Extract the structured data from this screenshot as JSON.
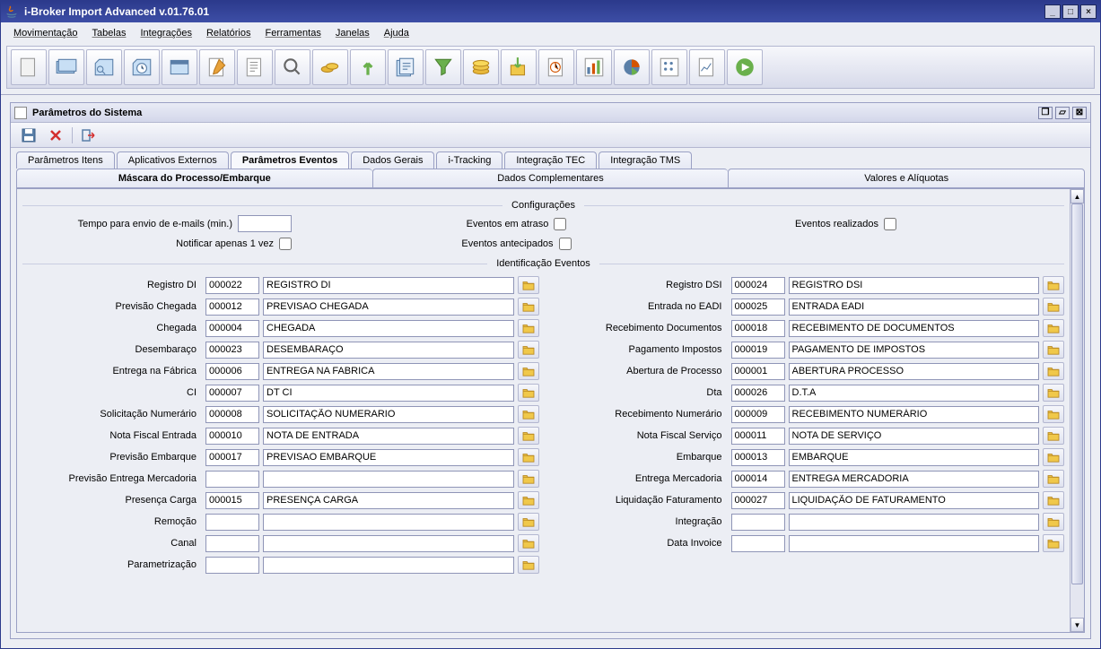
{
  "window": {
    "title": "i-Broker Import Advanced v.01.76.01"
  },
  "menus": [
    "Movimentação",
    "Tabelas",
    "Integrações",
    "Relatórios",
    "Ferramentas",
    "Janelas",
    "Ajuda"
  ],
  "inner": {
    "title": "Parâmetros do Sistema"
  },
  "tabs": [
    "Parâmetros Itens",
    "Aplicativos Externos",
    "Parâmetros Eventos",
    "Dados Gerais",
    "i-Tracking",
    "Integração TEC",
    "Integração TMS"
  ],
  "activeTab": 2,
  "subtabs": [
    "Máscara do Processo/Embarque",
    "Dados Complementares",
    "Valores e Alíquotas"
  ],
  "sections": {
    "config": "Configurações",
    "ident": "Identificação Eventos"
  },
  "config": {
    "tempo_label": "Tempo para envio de e-mails (min.)",
    "tempo_value": "",
    "notificar_label": "Notificar apenas 1 vez",
    "atraso_label": "Eventos em atraso",
    "antecipados_label": "Eventos antecipados",
    "realizados_label": "Eventos realizados"
  },
  "leftFields": [
    {
      "label": "Registro DI",
      "code": "000022",
      "desc": "REGISTRO DI"
    },
    {
      "label": "Previsão Chegada",
      "code": "000012",
      "desc": "PREVISAO CHEGADA"
    },
    {
      "label": "Chegada",
      "code": "000004",
      "desc": "CHEGADA"
    },
    {
      "label": "Desembaraço",
      "code": "000023",
      "desc": "DESEMBARAÇO"
    },
    {
      "label": "Entrega na Fábrica",
      "code": "000006",
      "desc": "ENTREGA NA FABRICA"
    },
    {
      "label": "CI",
      "code": "000007",
      "desc": "DT CI"
    },
    {
      "label": "Solicitação Numerário",
      "code": "000008",
      "desc": "SOLICITAÇÃO NUMERARIO"
    },
    {
      "label": "Nota Fiscal Entrada",
      "code": "000010",
      "desc": "NOTA DE ENTRADA"
    },
    {
      "label": "Previsão Embarque",
      "code": "000017",
      "desc": "PREVISAO EMBARQUE"
    },
    {
      "label": "Previsão Entrega Mercadoria",
      "code": "",
      "desc": ""
    },
    {
      "label": "Presença Carga",
      "code": "000015",
      "desc": "PRESENÇA CARGA"
    },
    {
      "label": "Remoção",
      "code": "",
      "desc": ""
    },
    {
      "label": "Canal",
      "code": "",
      "desc": ""
    },
    {
      "label": "Parametrização",
      "code": "",
      "desc": ""
    }
  ],
  "rightFields": [
    {
      "label": "Registro DSI",
      "code": "000024",
      "desc": "REGISTRO DSI"
    },
    {
      "label": "Entrada no EADI",
      "code": "000025",
      "desc": "ENTRADA EADI"
    },
    {
      "label": "Recebimento Documentos",
      "code": "000018",
      "desc": "RECEBIMENTO DE DOCUMENTOS"
    },
    {
      "label": "Pagamento Impostos",
      "code": "000019",
      "desc": "PAGAMENTO DE IMPOSTOS"
    },
    {
      "label": "Abertura de Processo",
      "code": "000001",
      "desc": "ABERTURA PROCESSO"
    },
    {
      "label": "Dta",
      "code": "000026",
      "desc": "D.T.A"
    },
    {
      "label": "Recebimento Numerário",
      "code": "000009",
      "desc": "RECEBIMENTO NUMERÁRIO"
    },
    {
      "label": "Nota Fiscal Serviço",
      "code": "000011",
      "desc": "NOTA DE SERVIÇO"
    },
    {
      "label": "Embarque",
      "code": "000013",
      "desc": "EMBARQUE"
    },
    {
      "label": "Entrega Mercadoria",
      "code": "000014",
      "desc": "ENTREGA MERCADORIA"
    },
    {
      "label": "Liquidação Faturamento",
      "code": "000027",
      "desc": "LIQUIDAÇÃO DE FATURAMENTO"
    },
    {
      "label": "Integração",
      "code": "",
      "desc": ""
    },
    {
      "label": "Data Invoice",
      "code": "",
      "desc": ""
    }
  ]
}
